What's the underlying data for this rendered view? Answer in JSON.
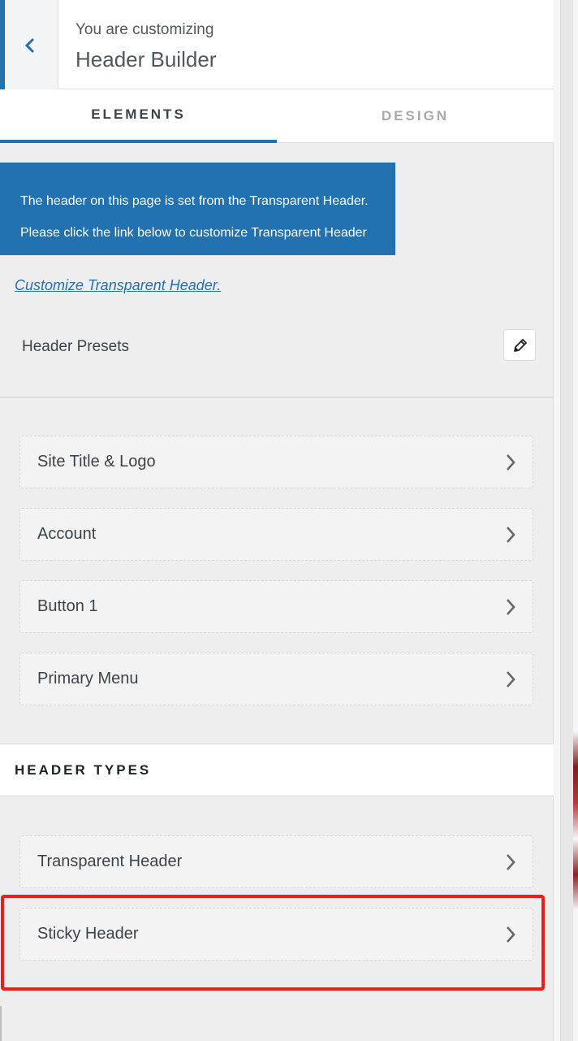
{
  "header": {
    "subtitle": "You are customizing",
    "title": "Header Builder"
  },
  "tabs": [
    {
      "label": "ELEMENTS",
      "active": true
    },
    {
      "label": "DESIGN",
      "active": false
    }
  ],
  "notice": {
    "line1": "The header on this page is set from the Transparent Header.",
    "line2": "Please click the link below to customize Transparent Header"
  },
  "link_text": "Customize Transparent Header.",
  "presets": {
    "label": "Header Presets",
    "icon": "pencil-icon"
  },
  "elements": [
    {
      "label": "Site Title & Logo"
    },
    {
      "label": "Account"
    },
    {
      "label": "Button 1"
    },
    {
      "label": "Primary Menu"
    }
  ],
  "header_types": {
    "heading": "HEADER TYPES",
    "items": [
      {
        "label": "Transparent Header"
      },
      {
        "label": "Sticky Header"
      }
    ]
  },
  "colors": {
    "accent": "#2271b1",
    "highlight": "#ee1c1c"
  }
}
